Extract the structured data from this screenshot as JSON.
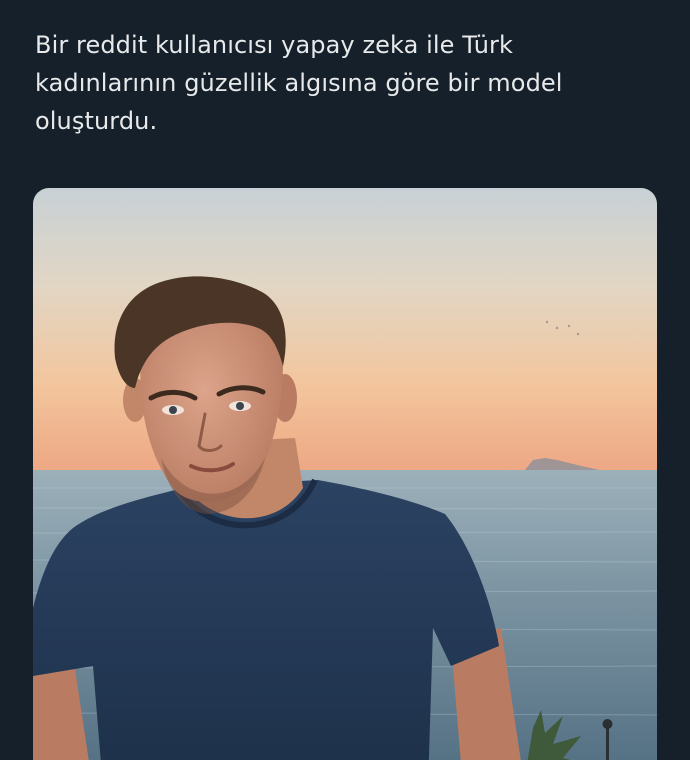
{
  "tweet": {
    "text": "Bir reddit kullanıcısı yapay zeka ile Türk kadınlarının güzellik algısına göre bir model oluşturdu."
  },
  "media": {
    "alt": "",
    "colors": {
      "background": "#15202b",
      "text": "#e7e9ea",
      "sky_top": "#c9d2d8",
      "sky_horizon": "#f0b58a",
      "sea": "#6f8796",
      "shirt": "#253a57",
      "skin": "#c98e73",
      "hair": "#4a3526"
    }
  }
}
